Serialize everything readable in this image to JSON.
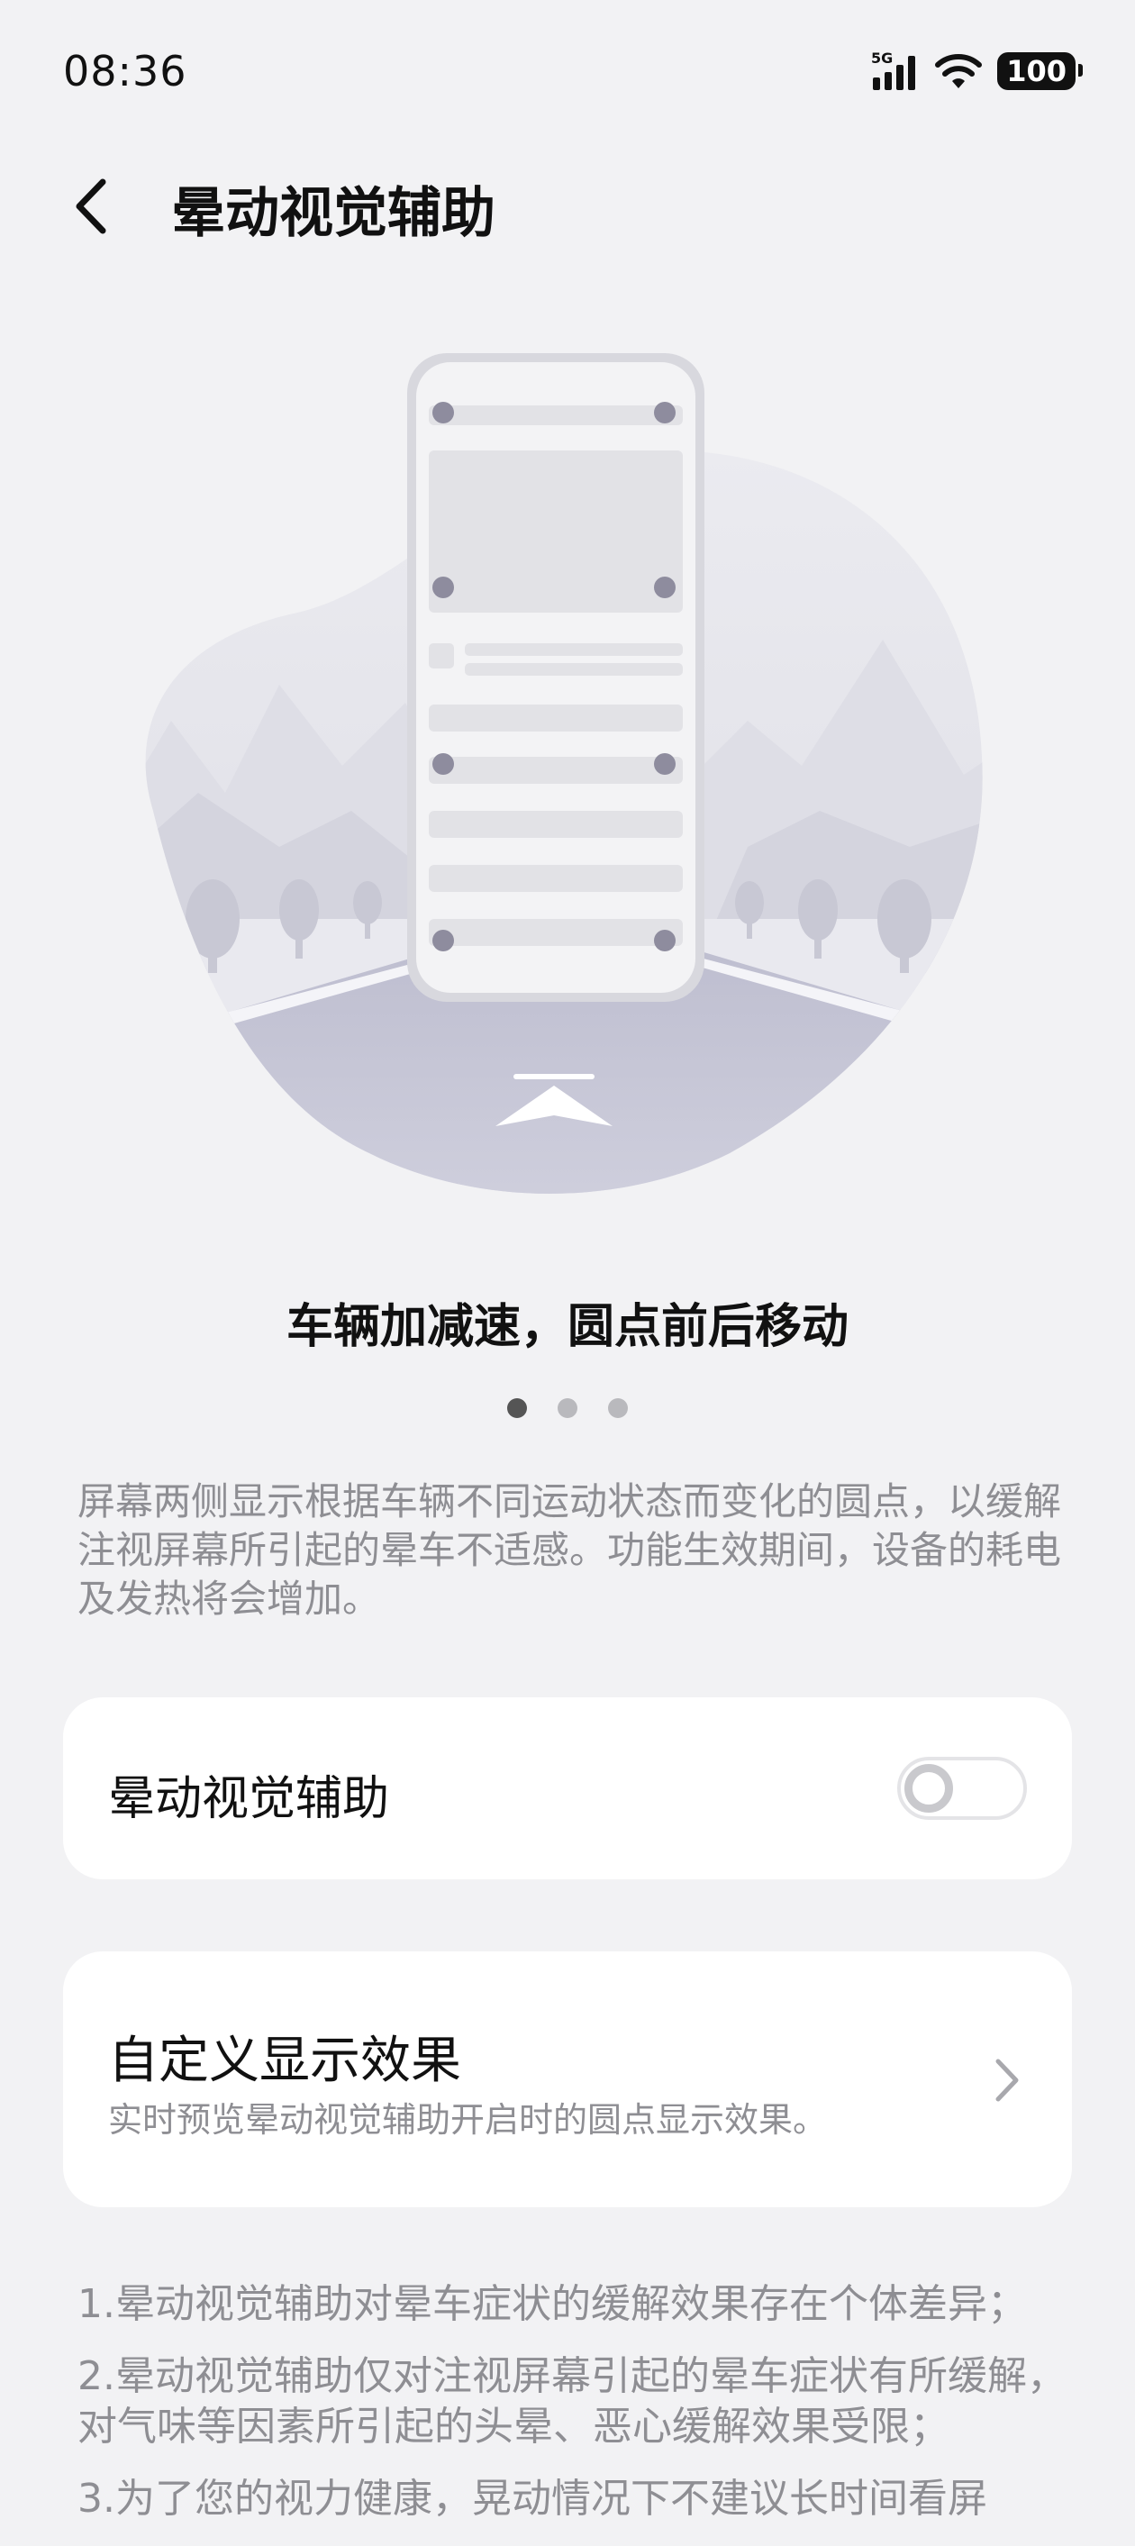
{
  "status_bar": {
    "time": "08:36",
    "network": "5G",
    "battery": "100"
  },
  "header": {
    "title": "晕动视觉辅助"
  },
  "carousel": {
    "caption": "车辆加减速，圆点前后移动",
    "pages": 3,
    "active_page": 1
  },
  "description": "屏幕两侧显示根据车辆不同运动状态而变化的圆点，以缓解注视屏幕所引起的晕车不适感。功能生效期间，设备的耗电及发热将会增加。",
  "toggle_card": {
    "label": "晕动视觉辅助",
    "enabled": false
  },
  "custom_card": {
    "title": "自定义显示效果",
    "subtitle": "实时预览晕动视觉辅助开启时的圆点显示效果。"
  },
  "notes": [
    "1.晕动视觉辅助对晕车症状的缓解效果存在个体差异；",
    "2.晕动视觉辅助仅对注视屏幕引起的晕车症状有所缓解，对气味等因素所引起的头晕、恶心缓解效果受限；",
    "3.为了您的视力健康，晃动情况下不建议长时间看屏"
  ],
  "colors": {
    "background": "#f2f2f4",
    "card": "#ffffff",
    "secondary_text": "#8e8e93",
    "active_dot": "#555555",
    "inactive_dot": "#b9b9bd"
  }
}
